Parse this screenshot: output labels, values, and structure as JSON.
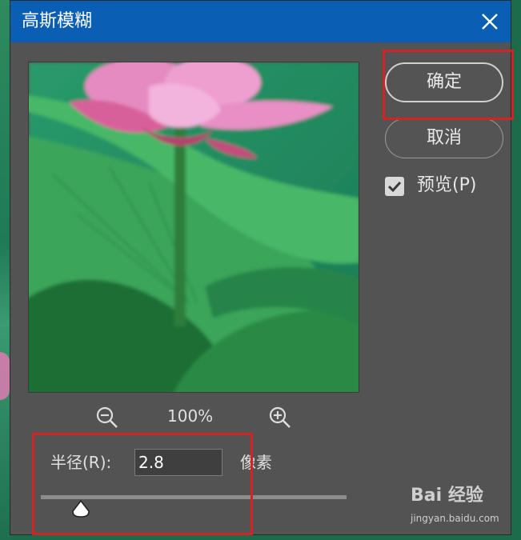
{
  "dialog": {
    "title": "高斯模糊"
  },
  "buttons": {
    "ok_label": "确定",
    "cancel_label": "取消"
  },
  "preview_option": {
    "label": "预览(P)",
    "checked": true
  },
  "zoom": {
    "value": "100%"
  },
  "radius": {
    "label": "半径(R):",
    "value": "2.8",
    "unit": "像素",
    "slider_position": 0.13
  },
  "watermark": {
    "logo_text": "Bai 经验",
    "url": "jingyan.baidu.com"
  },
  "icons": {
    "close": "close-icon",
    "zoom_out": "zoom-out-icon",
    "zoom_in": "zoom-in-icon",
    "checkbox": "check-icon"
  },
  "colors": {
    "titlebar": "#0a5fb4",
    "dialog_bg": "#535353",
    "highlight": "#d22424"
  }
}
